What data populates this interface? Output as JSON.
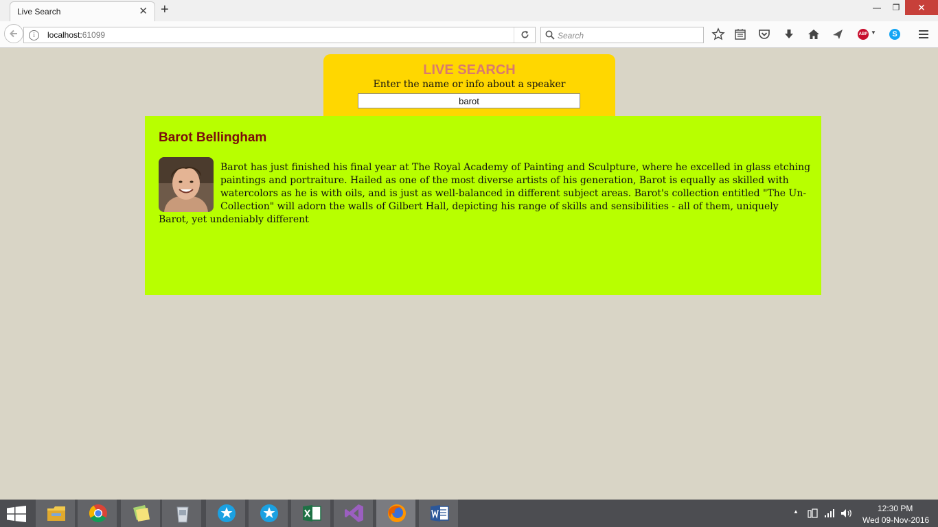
{
  "browser": {
    "tab_title": "Live Search",
    "url_host": "localhost:",
    "url_port": "61099",
    "search_placeholder": "Search",
    "abp_label": "ABP",
    "skype_label": "S"
  },
  "page": {
    "heading": "LIVE SEARCH",
    "instruction": "Enter the name or info about a speaker",
    "search_value": "barot",
    "colors": {
      "header_bg": "#ffd700",
      "heading": "#d97a6f",
      "results_bg": "#b8ff00",
      "name": "#7a0d0d",
      "page_bg": "#d9d5c6"
    },
    "results": [
      {
        "name": "Barot Bellingham",
        "bio": "Barot has just finished his final year at The Royal Academy of Painting and Sculpture, where he excelled in glass etching paintings and portraiture. Hailed as one of the most diverse artists of his generation, Barot is equally as skilled with watercolors as he is with oils, and is just as well-balanced in different subject areas. Barot's collection entitled \"The Un-Collection\" will adorn the walls of Gilbert Hall, depicting his range of skills and sensibilities - all of them, uniquely Barot, yet undeniably different"
      }
    ]
  },
  "taskbar": {
    "time": "12:30 PM",
    "date": "Wed 09-Nov-2016",
    "apps": [
      "file-explorer",
      "chrome",
      "sticky-notes",
      "recycle-bin",
      "app-star-1",
      "app-star-2",
      "excel",
      "visual-studio",
      "firefox",
      "word"
    ]
  }
}
